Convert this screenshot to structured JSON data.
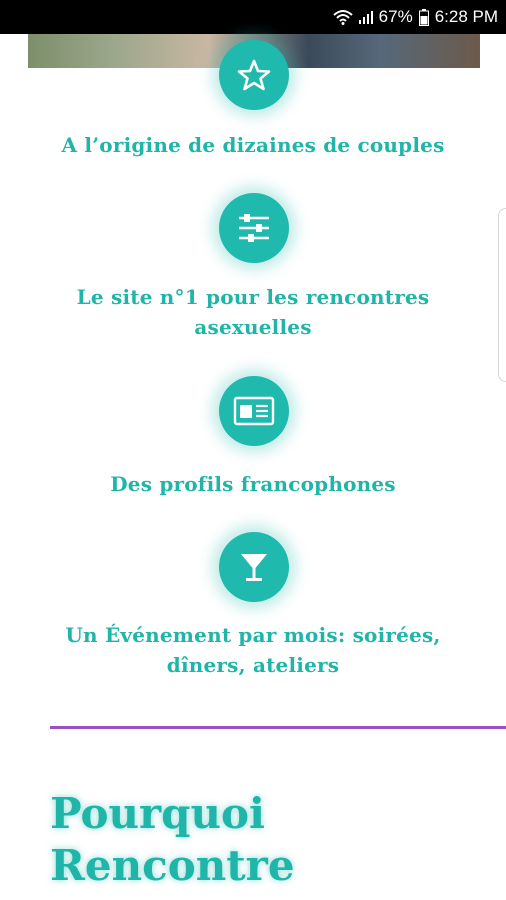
{
  "status_bar": {
    "battery": "67%",
    "time": "6:28 PM",
    "icons": [
      "wifi-icon",
      "signal-icon",
      "battery-icon"
    ]
  },
  "features": [
    {
      "icon": "star-icon",
      "text": "A l’origine de dizaines de couples"
    },
    {
      "icon": "sliders-icon",
      "text": "Le site n°1 pour les rencontres asexuelles"
    },
    {
      "icon": "id-card-icon",
      "text": "Des profils francophones"
    },
    {
      "icon": "cocktail-glass-icon",
      "text": "Un Événement par mois: soirées, dîners, ateliers"
    }
  ],
  "section": {
    "title": "Pourquoi\nRencontre"
  },
  "colors": {
    "accent": "#1fb9ae",
    "text_accent": "#1fb5a8",
    "divider": "#9b4fc4",
    "status_bar": "#000000"
  }
}
